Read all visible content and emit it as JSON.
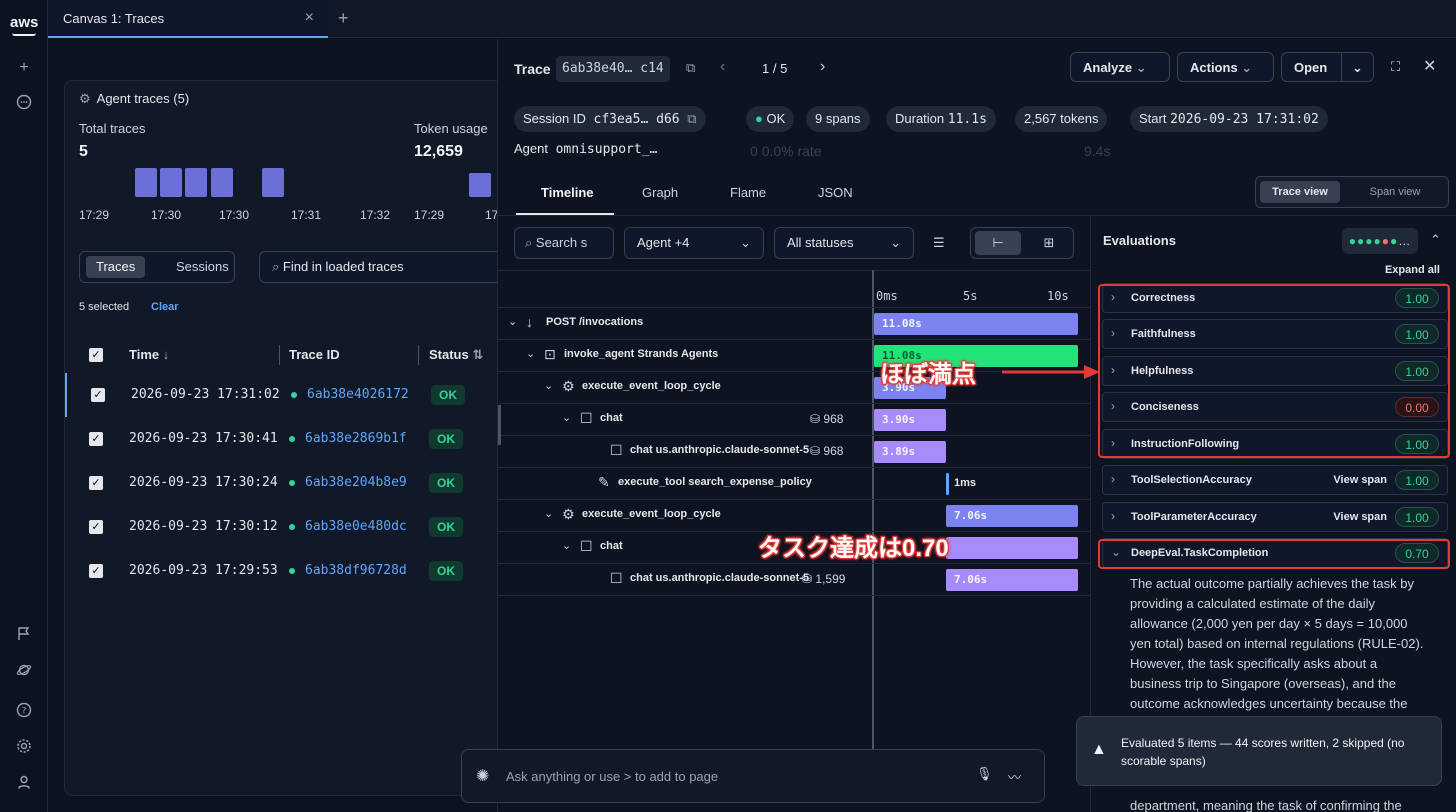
{
  "tab": {
    "title": "Canvas 1: Traces"
  },
  "rail": {
    "logo": "aws"
  },
  "left": {
    "title": "Agent traces (5)",
    "total_label": "Total traces",
    "total_value": "5",
    "token_label": "Token usage",
    "token_value": "12,659",
    "ticks": [
      "17:29",
      "17:30",
      "17:30",
      "17:31",
      "17:32",
      "17:29",
      "17"
    ],
    "seg": [
      "Traces",
      "Sessions"
    ],
    "find_placeholder": "Find in loaded traces",
    "selected": "5 selected",
    "clear": "Clear",
    "cols": {
      "time": "Time",
      "trace": "Trace ID",
      "status": "Status"
    },
    "rows": [
      {
        "time": "2026-09-23 17:31:02",
        "id": "6ab38e4026172",
        "status": "OK"
      },
      {
        "time": "2026-09-23 17:30:41",
        "id": "6ab38e2869b1f",
        "status": "OK"
      },
      {
        "time": "2026-09-23 17:30:24",
        "id": "6ab38e204b8e9",
        "status": "OK"
      },
      {
        "time": "2026-09-23 17:30:12",
        "id": "6ab38e0e480dc",
        "status": "OK"
      },
      {
        "time": "2026-09-23 17:29:53",
        "id": "6ab38df96728d",
        "status": "OK"
      }
    ]
  },
  "drawer": {
    "trace_label": "Trace",
    "trace_id": "6ab38e40… c14",
    "pager": "1 / 5",
    "analyze": "Analyze",
    "actions": "Actions",
    "open": "Open",
    "session_label": "Session ID",
    "session_id": "cf3ea5… d66",
    "status": "OK",
    "spans": "9 spans",
    "duration_label": "Duration",
    "duration": "11.1s",
    "tokens": "2,567 tokens",
    "start_label": "Start",
    "start": "2026-09-23 17:31:02",
    "agent_label": "Agent",
    "agent": "omnisupport_…",
    "ghost": {
      "a": "0",
      "b": "0.0% rate",
      "c": "9.4s"
    },
    "tabs": [
      "Timeline",
      "Graph",
      "Flame",
      "JSON"
    ],
    "views": [
      "Trace view",
      "Span view"
    ],
    "search_placeholder": "Search s",
    "agent_filter": "Agent +4",
    "status_filter": "All statuses",
    "axis": [
      "0ms",
      "5s",
      "10s"
    ],
    "spans_list": [
      {
        "name": "POST /invocations",
        "tokens": "",
        "bar": "11.08s"
      },
      {
        "name": "invoke_agent Strands Agents",
        "tokens": "",
        "bar": "11.08s"
      },
      {
        "name": "execute_event_loop_cycle",
        "tokens": "",
        "bar": "3.90s"
      },
      {
        "name": "chat",
        "tokens": "968",
        "bar": "3.90s"
      },
      {
        "name": "chat us.anthropic.claude-sonnet-5",
        "tokens": "968",
        "bar": "3.89s"
      },
      {
        "name": "execute_tool search_expense_policy",
        "tokens": "",
        "bar": "1ms"
      },
      {
        "name": "execute_event_loop_cycle",
        "tokens": "",
        "bar": "7.06s"
      },
      {
        "name": "chat",
        "tokens": "",
        "bar": ""
      },
      {
        "name": "chat us.anthropic.claude-sonnet-5",
        "tokens": "1,599",
        "bar": "7.06s"
      }
    ],
    "ask_placeholder": "Ask anything or use  > to add to page"
  },
  "evals": {
    "title": "Evaluations",
    "expand_all": "Expand all",
    "view_span": "View span",
    "items": [
      {
        "name": "Correctness",
        "score": "1.00"
      },
      {
        "name": "Faithfulness",
        "score": "1.00"
      },
      {
        "name": "Helpfulness",
        "score": "1.00"
      },
      {
        "name": "Conciseness",
        "score": "0.00"
      },
      {
        "name": "InstructionFollowing",
        "score": "1.00"
      },
      {
        "name": "ToolSelectionAccuracy",
        "score": "1.00"
      },
      {
        "name": "ToolParameterAccuracy",
        "score": "1.00"
      },
      {
        "name": "DeepEval.TaskCompletion",
        "score": "0.70"
      }
    ],
    "detail": "The actual outcome partially achieves the task by providing a calculated estimate of the daily allowance (2,000 yen per day × 5 days = 10,000 yen total) based on internal regulations (RULE-02). However, the task specifically asks about a business trip to Singapore (overseas), and the outcome acknowledges uncertainty because the",
    "detail_tail": "department, meaning the task of confirming the exact daily allowance amount was not fully",
    "toast": "Evaluated 5 items — 44 scores written, 2 skipped (no scorable spans)"
  },
  "annotations": {
    "a1": "ほぼ満点",
    "a2": "タスク達成は0.70"
  },
  "colors": {
    "accent": "#60a5fa",
    "ok": "#34d399",
    "bar_blue": "#7c83f0",
    "bar_green": "#22e37a",
    "bar_purple": "#a78bfa",
    "red": "#e53935",
    "bad": "#f87171"
  }
}
